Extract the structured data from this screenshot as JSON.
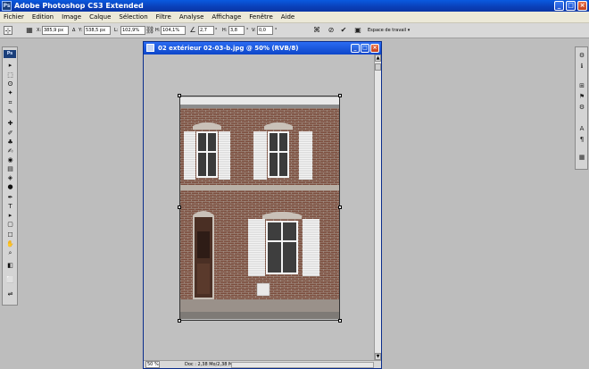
{
  "app": {
    "title": "Adobe Photoshop CS3 Extended",
    "logo_text": "Ps",
    "window_buttons": [
      "_",
      "□",
      "×"
    ]
  },
  "menu": [
    "Fichier",
    "Edition",
    "Image",
    "Calque",
    "Sélection",
    "Filtre",
    "Analyse",
    "Affichage",
    "Fenêtre",
    "Aide"
  ],
  "options": {
    "x_label": "X:",
    "x_value": "385,9 px",
    "y_label": "Y:",
    "y_value": "538,5 px",
    "w_label": "L:",
    "w_value": "102,9%",
    "h_label": "H:",
    "h_value": "104,1%",
    "angle_value": "2,7",
    "angle_unit": "°",
    "skew_h_label": "H:",
    "skew_h_value": "3,8",
    "skew_v_label": "V:",
    "skew_v_value": "0,0",
    "workspace_label": "Espace de travail ▾"
  },
  "toolbox": {
    "badge": "Ps",
    "tools": [
      "▸",
      "⬚",
      "ʘ",
      "✦",
      "⌗",
      "✎",
      "✚",
      "✐",
      "♣",
      "✍",
      "◉",
      "▤",
      "◈",
      "●",
      "✒",
      "T",
      "▸",
      "▢",
      "☐",
      "✋",
      "⌕",
      "◧",
      "⬜",
      "⇌"
    ]
  },
  "dock_icons": [
    "⚙",
    "ℹ",
    "⊞",
    "⚑",
    "⚙",
    "A",
    "¶",
    "▦"
  ],
  "document": {
    "title": "02 extérieur 02-03-b.jpg @ 50% (RVB/8)",
    "zoom": "50 %",
    "status": "Doc : 2,38 Mo/2,38 Mo",
    "buttons": [
      "_",
      "□",
      "×"
    ],
    "scroll_up": "▲",
    "scroll_down": "▼"
  },
  "colors": {
    "brick": "#7a4a3a",
    "shutter": "#f2f2f2",
    "window_titlebar": "#0d46c9"
  }
}
